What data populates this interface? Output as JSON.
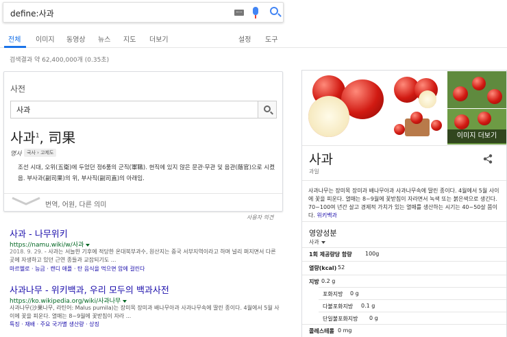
{
  "search": {
    "query": "define:사과"
  },
  "tabs": {
    "items": [
      "전체",
      "이미지",
      "동영상",
      "뉴스",
      "지도",
      "더보기"
    ],
    "right": [
      "설정",
      "도구"
    ]
  },
  "stats": "검색결과 약 62,400,000개 (0.35초)",
  "dictionary": {
    "section_title": "사전",
    "input_value": "사과",
    "headword": "사과",
    "superscript": "1",
    "hanja": ", 司果",
    "pos": "명사",
    "badge": "국사 › 고제도",
    "definition": "조선 시대, 오위(五衛)에 두었던 정6품의 군직(軍職). 현직에 있지 않은 문관·무관 및 음관(蔭官)으로 시켰음. 부사과(副司果)의 위, 부사직(副司直)의 아래임.",
    "more": "번역, 어원, 다른 의미"
  },
  "feedback": "사용자 의견",
  "results": [
    {
      "title": "사과 - 나무위키",
      "url": "https://namu.wiki/w/사과",
      "snippet_date": "2018. 9. 29.",
      "snippet": " - 사과는 서늘한 기후에 적당한 온대북부과수, 원산지는 중국 서부지역이라고 하며 널리 퍼지면서 다른 곳에 자생하고 있던 근연 종들과 교잡되기도 ...",
      "links": "마르헬로 · 능금 · 캔디 애플 · 탄 음식을 먹으면 암에 걸린다"
    },
    {
      "title": "사과나무 - 위키백과, 우리 모두의 백과사전",
      "url": "https://ko.wikipedia.org/wiki/사과나무",
      "snippet": "사과나무(沙果나무, 라틴어: Malus pumila)는 장미목 장미과 배나무아과 사과나무속에 딸린 종이다. 4월에서 5월 사이에 꽃을 피운다. 열매는 8~9월에 꽃받침이 자라 ...",
      "links": "특징 · 재배 · 주요 국가별 생산량 · 상징"
    }
  ],
  "knowledge_panel": {
    "more_images": "이미지 더보기",
    "name": "사과",
    "type": "과일",
    "description": "사과나무는 장미목 장미과 배나무아과 사과나무속에 딸린 종이다. 4월에서 5월 사이에 꽃을 피운다. 열매는 8~9월에 꽃받침이 자라면서 녹색 또는 붉은색으로 생긴다. 70~100여 년간 살고 경제적 가치가 있는 열매를 생산하는 시기는 40~50살 쯤이다.",
    "description_link": "위키백과",
    "nutrition_title": "영양성분",
    "nutrition_selector": "사과",
    "rows": [
      {
        "label": "1회 제공량당 함량",
        "value": "100g",
        "bold": true
      },
      {
        "label": "열량(kcal)",
        "value": "52",
        "bold": true
      },
      {
        "label": "지방",
        "value": "0.2 g",
        "bold": false
      },
      {
        "label": "포화지방",
        "value": "0 g",
        "bold": false
      },
      {
        "label": "다불포화지방",
        "value": "0.1 g",
        "bold": false
      },
      {
        "label": "단일불포화지방",
        "value": "0 g",
        "bold": false
      },
      {
        "label": "콜레스테롤",
        "value": "0 mg",
        "bold": false
      }
    ]
  }
}
